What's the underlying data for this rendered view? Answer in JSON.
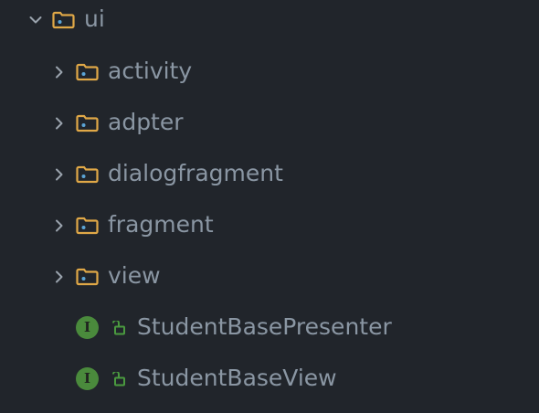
{
  "tree": {
    "root": {
      "label": "ui",
      "expanded": true,
      "icon": "folder-icon"
    },
    "folders": [
      {
        "label": "activity",
        "expanded": false,
        "icon": "folder-icon"
      },
      {
        "label": "adpter",
        "expanded": false,
        "icon": "folder-icon"
      },
      {
        "label": "dialogfragment",
        "expanded": false,
        "icon": "folder-icon"
      },
      {
        "label": "fragment",
        "expanded": false,
        "icon": "folder-icon"
      },
      {
        "label": "view",
        "expanded": false,
        "icon": "folder-icon"
      }
    ],
    "files": [
      {
        "label": "StudentBasePresenter",
        "badge": "I",
        "icon": "interface-icon",
        "access": "lock-open-icon"
      },
      {
        "label": "StudentBaseView",
        "badge": "I",
        "icon": "interface-icon",
        "access": "lock-open-icon"
      }
    ]
  },
  "colors": {
    "background": "#21252b",
    "label": "#8a96a3",
    "folder": "#e0a847",
    "folder_dot": "#5ba4d6",
    "chevron": "#9aa3ad",
    "interface_badge": "#4a8a3c",
    "lock": "#4a9a3f"
  }
}
